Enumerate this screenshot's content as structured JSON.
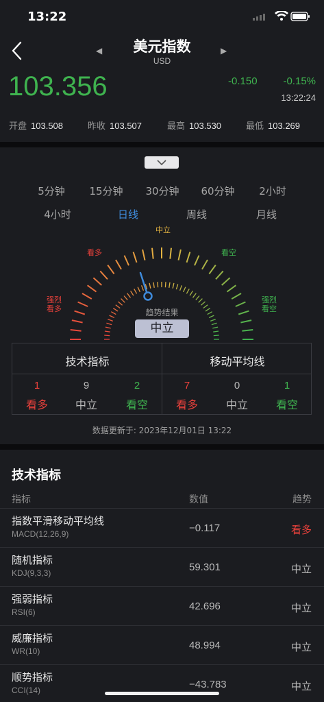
{
  "status": {
    "time": "13:22"
  },
  "header": {
    "title": "美元指数",
    "subtitle": "USD"
  },
  "quote": {
    "price": "103.356",
    "change": "-0.150",
    "change_pct": "-0.15%",
    "time": "13:22:24",
    "stats": [
      {
        "label": "开盘",
        "value": "103.508"
      },
      {
        "label": "昨收",
        "value": "103.507"
      },
      {
        "label": "最高",
        "value": "103.530"
      },
      {
        "label": "最低",
        "value": "103.269"
      }
    ]
  },
  "periods": [
    "5分钟",
    "15分钟",
    "30分钟",
    "60分钟",
    "2小时",
    "4小时",
    "日线",
    "周线",
    "月线"
  ],
  "active_period": "日线",
  "gauge": {
    "labels": {
      "neutral": "中立",
      "buy": "看多",
      "sell": "看空",
      "strong_buy": "强烈\n看多",
      "strong_sell": "强烈\n看空"
    },
    "strong_buy_lines": [
      "强烈",
      "看多"
    ],
    "strong_sell_lines": [
      "强烈",
      "看空"
    ],
    "result_label": "趋势结果",
    "result": "中立",
    "needle_level": 0.42,
    "colors": {
      "buy": "#e8413b",
      "neutral": "#e3b341",
      "sell": "#3fb34f"
    }
  },
  "summary": {
    "technical": {
      "title": "技术指标",
      "buy": "1",
      "neutral": "9",
      "sell": "2"
    },
    "moving_avg": {
      "title": "移动平均线",
      "buy": "7",
      "neutral": "0",
      "sell": "1"
    },
    "buy_label": "看多",
    "neutral_label": "中立",
    "sell_label": "看空"
  },
  "updated": "数据更新于: 2023年12月01日 13:22",
  "indicators": {
    "section_title": "技术指标",
    "headers": {
      "name": "指标",
      "value": "数值",
      "trend": "趋势"
    },
    "rows": [
      {
        "name": "指数平滑移动平均线",
        "code": "MACD(12,26,9)",
        "value": "−0.117",
        "trend": "看多",
        "trend_color": "red"
      },
      {
        "name": "随机指标",
        "code": "KDJ(9,3,3)",
        "value": "59.301",
        "trend": "中立",
        "trend_color": "gray"
      },
      {
        "name": "强弱指标",
        "code": "RSI(6)",
        "value": "42.696",
        "trend": "中立",
        "trend_color": "gray"
      },
      {
        "name": "威廉指标",
        "code": "WR(10)",
        "value": "48.994",
        "trend": "中立",
        "trend_color": "gray"
      },
      {
        "name": "顺势指标",
        "code": "CCI(14)",
        "value": "−43.783",
        "trend": "中立",
        "trend_color": "gray"
      }
    ]
  }
}
